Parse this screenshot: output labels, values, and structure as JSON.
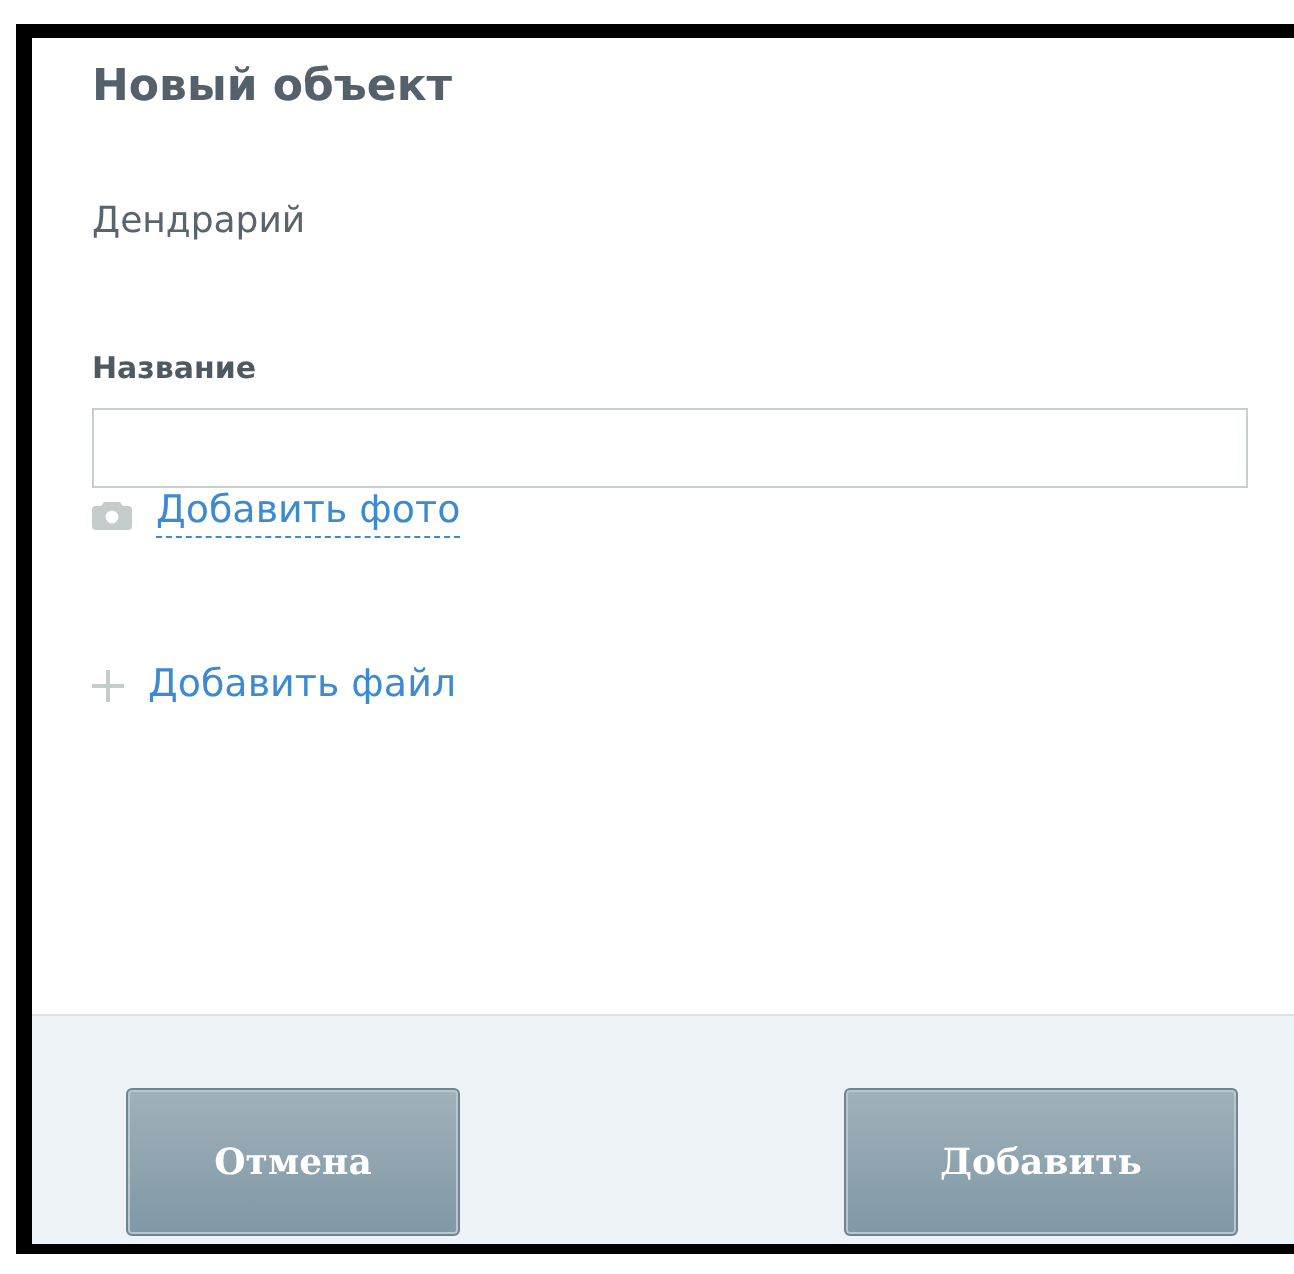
{
  "dialog": {
    "title": "Новый объект",
    "subtitle": "Дендрарий"
  },
  "field": {
    "label": "Название"
  },
  "actions": [
    {
      "kind": "photo",
      "label": "Добавить фото"
    },
    {
      "kind": "file",
      "label": "Добавить файл"
    }
  ],
  "buttons": [
    "Отмена",
    "Добавить"
  ]
}
